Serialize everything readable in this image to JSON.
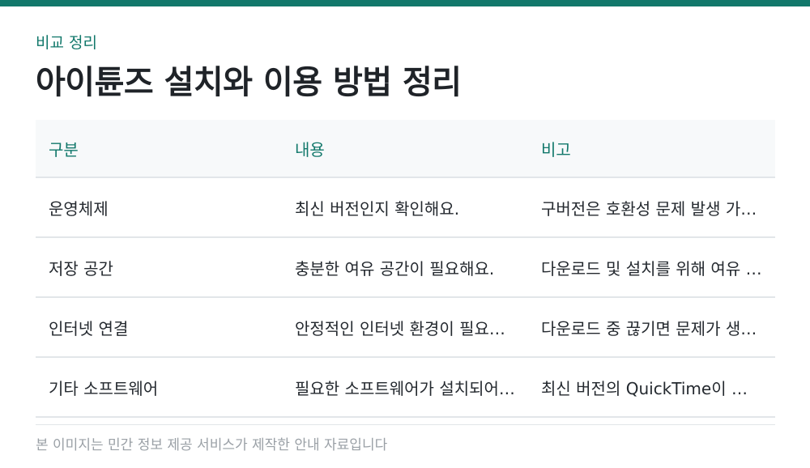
{
  "colors": {
    "accent": "#12786b",
    "text": "#1f2328",
    "muted": "#9aa0a6",
    "header_bg": "#f7f9fa",
    "divider": "#e2e6e9"
  },
  "header": {
    "eyebrow": "비교 정리",
    "title": "아이튠즈 설치와 이용 방법 정리"
  },
  "table": {
    "columns": [
      "구분",
      "내용",
      "비고"
    ],
    "rows": [
      [
        "운영체제",
        "최신 버전인지 확인해요.",
        "구버전은 호환성 문제 발생 가능성이 있어요"
      ],
      [
        "저장 공간",
        "충분한 여유 공간이 필요해요.",
        "다운로드 및 설치를 위해 여유 공간이 필요해요"
      ],
      [
        "인터넷 연결",
        "안정적인 인터넷 환경이 필요해요.",
        "다운로드 중 끊기면 문제가 생길 수 있어요"
      ],
      [
        "기타 소프트웨어",
        "필요한 소프트웨어가 설치되어 있어야 해요.",
        "최신 버전의 QuickTime이 필요해요"
      ]
    ]
  },
  "footer": {
    "note": "본 이미지는 민간 정보 제공 서비스가 제작한 안내 자료입니다"
  }
}
